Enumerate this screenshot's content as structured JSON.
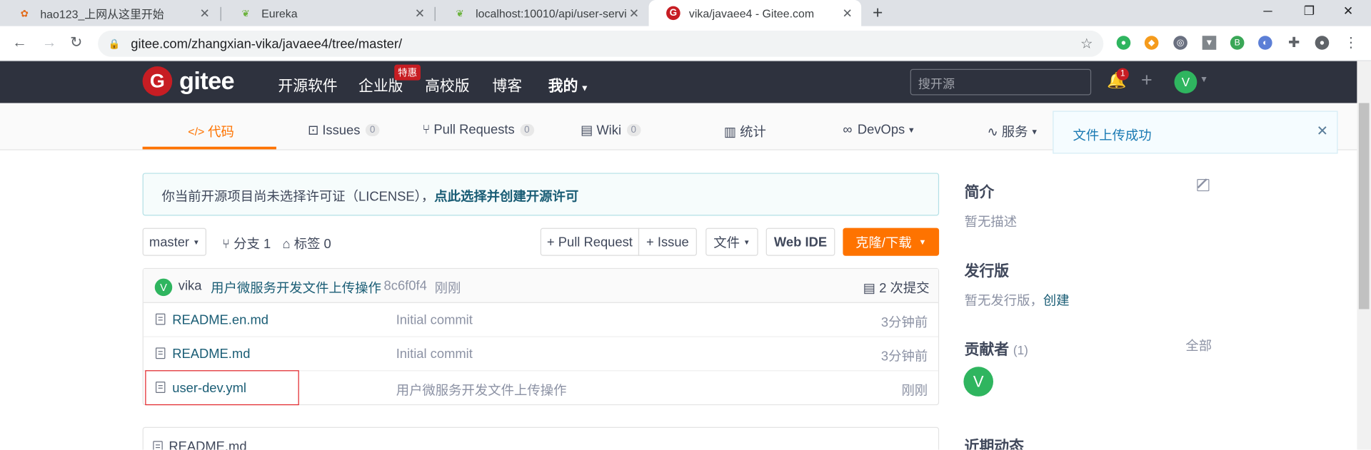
{
  "browser": {
    "tabs": [
      {
        "title": "hao123_上网从这里开始",
        "icon": "hao123-icon"
      },
      {
        "title": "Eureka",
        "icon": "spring-leaf-icon"
      },
      {
        "title": "localhost:10010/api/user-servi",
        "icon": "spring-leaf-icon"
      },
      {
        "title": "vika/javaee4 - Gitee.com",
        "icon": "gitee-icon"
      }
    ],
    "url": "gitee.com/zhangxian-vika/javaee4/tree/master/"
  },
  "header": {
    "logo_text": "gitee",
    "nav": [
      "开源软件",
      "企业版",
      "高校版",
      "博客",
      "我的"
    ],
    "hot_badge": "特惠",
    "search_placeholder": "搜开源",
    "notification_count": "1",
    "avatar_letter": "V"
  },
  "repo_tabs": {
    "code": "代码",
    "issues": "Issues",
    "issues_count": "0",
    "pull_requests": "Pull Requests",
    "pull_requests_count": "0",
    "wiki": "Wiki",
    "wiki_count": "0",
    "stats": "统计",
    "devops": "DevOps",
    "service": "服务"
  },
  "toast": {
    "message": "文件上传成功"
  },
  "notice": {
    "text": "你当前开源项目尚未选择许可证（LICENSE），",
    "link": "点此选择并创建开源许可"
  },
  "toolbar": {
    "branch": "master",
    "branches": "分支 1",
    "tags": "标签 0",
    "pull_request": "+ Pull Request",
    "issue": "+ Issue",
    "file": "文件",
    "web_ide": "Web IDE",
    "clone": "克隆/下载"
  },
  "commit": {
    "avatar_letter": "V",
    "author": "vika",
    "message": "用户微服务开发文件上传操作",
    "hash": "8c6f0f4",
    "time": "刚刚",
    "count": "2 次提交"
  },
  "files": [
    {
      "name": "README.en.md",
      "message": "Initial commit",
      "time": "3分钟前"
    },
    {
      "name": "README.md",
      "message": "Initial commit",
      "time": "3分钟前"
    },
    {
      "name": "user-dev.yml",
      "message": "用户微服务开发文件上传操作",
      "time": "刚刚"
    }
  ],
  "readme": {
    "title": "README.md"
  },
  "sidebar": {
    "intro_title": "简介",
    "intro_text": "暂无描述",
    "release_title": "发行版",
    "release_text": "暂无发行版，",
    "release_link": "创建",
    "contributors_title": "贡献者",
    "contributors_count": "(1)",
    "contributors_all": "全部",
    "contributor_avatar": "V",
    "activity_title": "近期动态"
  }
}
